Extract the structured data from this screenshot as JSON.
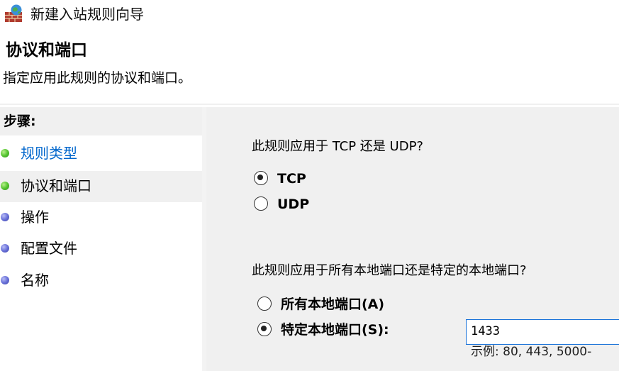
{
  "window": {
    "title": "新建入站规则向导",
    "icon": "firewall-icon"
  },
  "header": {
    "title": "协议和端口",
    "subtitle": "指定应用此规则的协议和端口。"
  },
  "steps": {
    "header": "步骤:",
    "items": [
      {
        "label": "规则类型",
        "bullet": "green",
        "state": "link"
      },
      {
        "label": "协议和端口",
        "bullet": "green",
        "state": "current"
      },
      {
        "label": "操作",
        "bullet": "blue",
        "state": "pending"
      },
      {
        "label": "配置文件",
        "bullet": "blue",
        "state": "pending"
      },
      {
        "label": "名称",
        "bullet": "blue",
        "state": "pending"
      }
    ]
  },
  "protocol": {
    "question": "此规则应用于 TCP 还是 UDP?",
    "options": [
      {
        "label": "TCP",
        "checked": true
      },
      {
        "label": "UDP",
        "checked": false
      }
    ]
  },
  "ports": {
    "question": "此规则应用于所有本地端口还是特定的本地端口?",
    "options": [
      {
        "label": "所有本地端口(A)",
        "checked": false
      },
      {
        "label": "特定本地端口(S):",
        "checked": true
      }
    ],
    "input_value": "1433",
    "example": "示例: 80, 443, 5000-"
  },
  "colors": {
    "link": "#0066cc",
    "content_bg": "#f0f0f0",
    "input_border": "#1a73d9",
    "bullet_green": "#55c531",
    "bullet_blue": "#6870d8"
  }
}
